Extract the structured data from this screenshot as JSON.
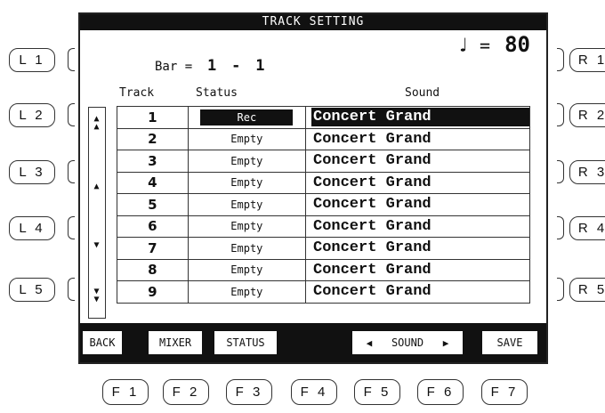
{
  "screen": {
    "title": "TRACK SETTING",
    "bar_label": "Bar =",
    "bar_start": "1",
    "bar_dash": "-",
    "bar_end": "1",
    "tempo_note": "♩",
    "tempo_equals": "=",
    "tempo_value": "80"
  },
  "table": {
    "headers": {
      "track": "Track",
      "status": "Status",
      "sound": "Sound"
    },
    "rows": [
      {
        "track": "1",
        "status": "Rec",
        "sound": "Concert Grand",
        "selected": true
      },
      {
        "track": "2",
        "status": "Empty",
        "sound": "Concert Grand"
      },
      {
        "track": "3",
        "status": "Empty",
        "sound": "Concert Grand"
      },
      {
        "track": "4",
        "status": "Empty",
        "sound": "Concert Grand"
      },
      {
        "track": "5",
        "status": "Empty",
        "sound": "Concert Grand"
      },
      {
        "track": "6",
        "status": "Empty",
        "sound": "Concert Grand"
      },
      {
        "track": "7",
        "status": "Empty",
        "sound": "Concert Grand"
      },
      {
        "track": "8",
        "status": "Empty",
        "sound": "Concert Grand"
      },
      {
        "track": "9",
        "status": "Empty",
        "sound": "Concert Grand"
      }
    ]
  },
  "scroll_icons": [
    "page-up-icon",
    "up-icon",
    "down-icon",
    "page-down-icon"
  ],
  "softkeys": {
    "back": "BACK",
    "mixer": "MIXER",
    "status": "STATUS",
    "sound": "SOUND",
    "save": "SAVE"
  },
  "hardware": {
    "left": [
      "L 1",
      "L 2",
      "L 3",
      "L 4",
      "L 5"
    ],
    "right": [
      "R 1",
      "R 2",
      "R 3",
      "R 4",
      "R 5"
    ],
    "bottom": [
      "F 1",
      "F 2",
      "F 3",
      "F 4",
      "F 5",
      "F 6",
      "F 7"
    ]
  },
  "colors": {
    "display_bg": "#ffffff",
    "ink": "#111111"
  }
}
